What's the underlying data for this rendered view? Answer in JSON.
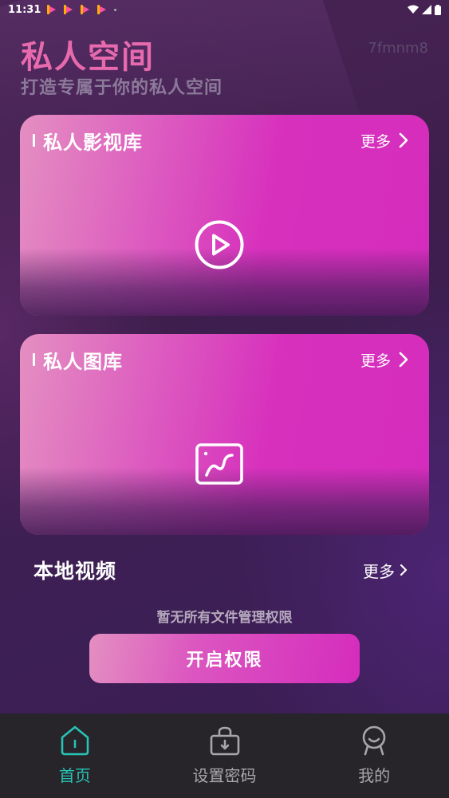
{
  "status_bar": {
    "time": "11:31"
  },
  "header": {
    "title": "私人空间",
    "subtitle": "打造专属于你的私人空间",
    "user_id": "7fmnm8"
  },
  "cards": [
    {
      "title": "私人影视库",
      "more_label": "更多",
      "icon": "play-circle-icon"
    },
    {
      "title": "私人图库",
      "more_label": "更多",
      "icon": "image-icon"
    }
  ],
  "local_videos": {
    "title": "本地视频",
    "more_label": "更多",
    "empty_tip": "暂无所有文件管理权限",
    "open_button_label": "开启权限"
  },
  "tab_bar": {
    "tabs": [
      {
        "label": "首页",
        "icon": "home-icon",
        "active": true
      },
      {
        "label": "设置密码",
        "icon": "lock-icon",
        "active": false
      },
      {
        "label": "我的",
        "icon": "profile-icon",
        "active": false
      }
    ]
  },
  "colors": {
    "accent": "#27c3b5",
    "title_pink": "#e86aae",
    "card_gradient_start": "#e48fc1",
    "card_gradient_end": "#d52cbd",
    "tab_bar_bg": "#27252a"
  }
}
